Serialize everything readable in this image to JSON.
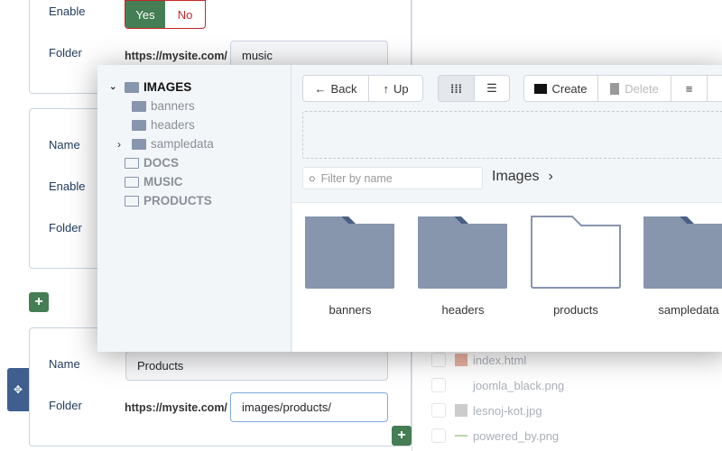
{
  "form": {
    "card1": {
      "enable_label": "Enable",
      "yes": "Yes",
      "no": "No",
      "folder_label": "Folder",
      "url_prefix": "https://mysite.com/",
      "folder_value": "music"
    },
    "card2": {
      "name_label": "Name",
      "enable_label": "Enable",
      "folder_label": "Folder"
    },
    "card3": {
      "name_label": "Name",
      "name_value": "Products",
      "folder_label": "Folder",
      "url_prefix": "https://mysite.com/",
      "folder_value": "images/products/"
    },
    "add_button": "+",
    "colors": {
      "accent": "#457d54",
      "no": "#c52827",
      "drag": "#3f5f8f"
    }
  },
  "files": [
    {
      "name": "index.html"
    },
    {
      "name": "joomla_black.png"
    },
    {
      "name": "lesnoj-kot.jpg"
    },
    {
      "name": "powered_by.png"
    }
  ],
  "media": {
    "tree": [
      {
        "label": "IMAGES"
      },
      {
        "label": "banners"
      },
      {
        "label": "headers"
      },
      {
        "label": "sampledata"
      },
      {
        "label": "DOCS"
      },
      {
        "label": "MUSIC"
      },
      {
        "label": "PRODUCTS"
      }
    ],
    "toolbar": {
      "back": "Back",
      "up": "Up",
      "create": "Create",
      "delete": "Delete"
    },
    "filter_placeholder": "Filter by name",
    "breadcrumb": "Images",
    "folders": [
      {
        "name": "banners"
      },
      {
        "name": "headers"
      },
      {
        "name": "products"
      },
      {
        "name": "sampledata"
      }
    ]
  }
}
